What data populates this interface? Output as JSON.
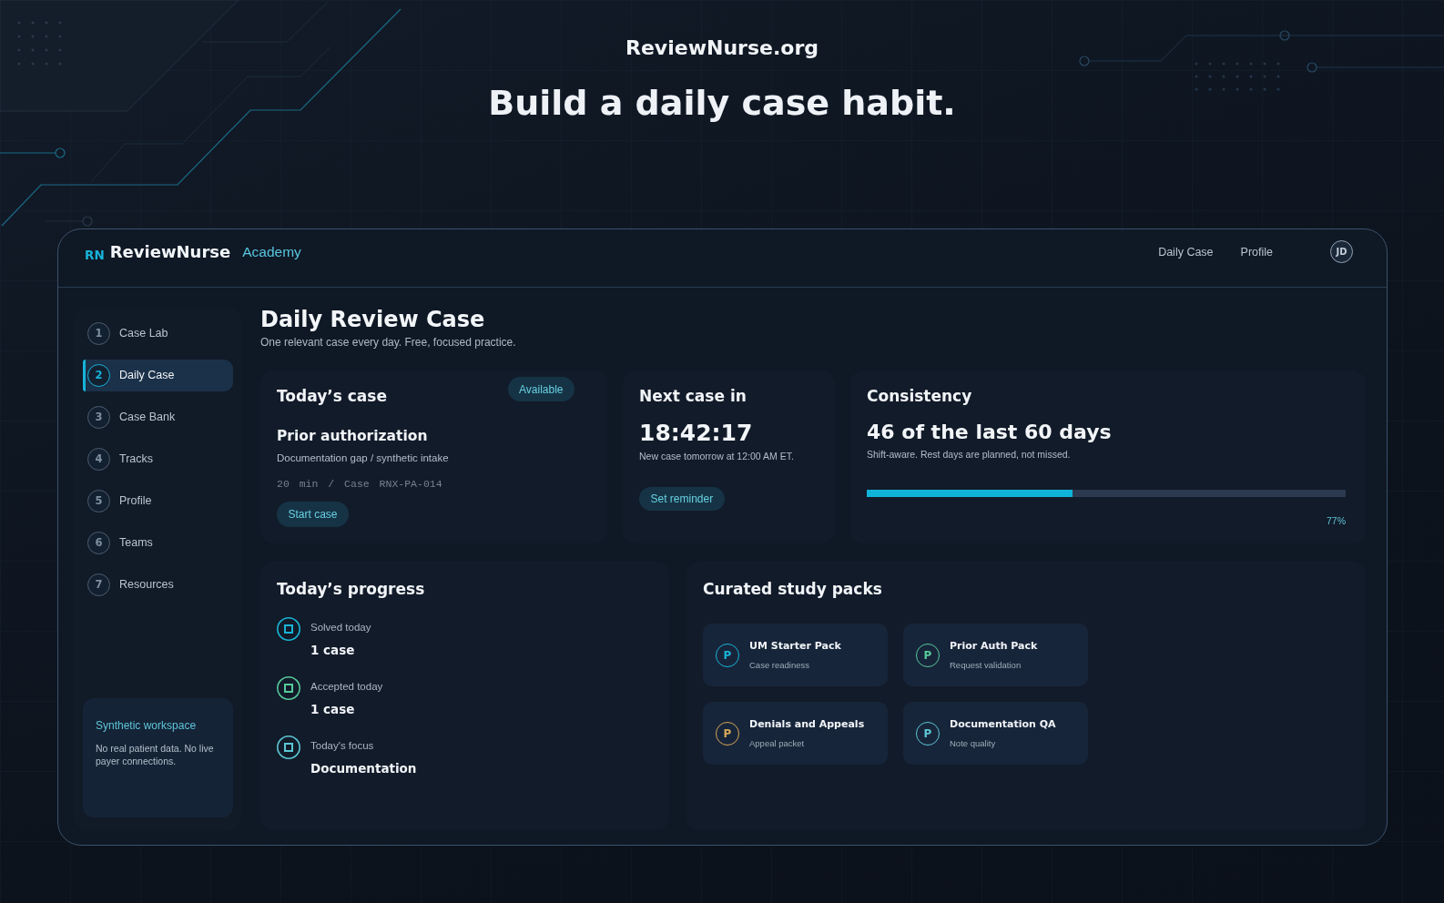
{
  "site": {
    "domain": "ReviewNurse.org",
    "headline": "Build a daily case habit."
  },
  "header": {
    "logo_mark": "RN",
    "brand": "ReviewNurse",
    "product": "Academy",
    "nav": [
      "Daily Case",
      "Profile"
    ],
    "avatar_initials": "JD"
  },
  "sidebar": {
    "items": [
      {
        "number": "1",
        "label": "Case Lab",
        "selected": false
      },
      {
        "number": "2",
        "label": "Daily Case",
        "selected": true
      },
      {
        "number": "3",
        "label": "Case Bank",
        "selected": false
      },
      {
        "number": "4",
        "label": "Tracks",
        "selected": false
      },
      {
        "number": "5",
        "label": "Profile",
        "selected": false
      },
      {
        "number": "6",
        "label": "Teams",
        "selected": false
      },
      {
        "number": "7",
        "label": "Resources",
        "selected": false
      }
    ],
    "notice": {
      "title": "Synthetic workspace",
      "text": "No real patient data. No live payer connections."
    }
  },
  "page": {
    "title": "Daily Review Case",
    "subtitle": "One relevant case every day. Free, focused practice."
  },
  "todays_case": {
    "title": "Today’s case",
    "status": "Available",
    "case_title": "Prior authorization",
    "description": "Documentation gap / synthetic intake",
    "meta": "20 min / Case RNX-PA-014",
    "button": "Start case"
  },
  "next_case": {
    "title": "Next case in",
    "countdown": "18:42:17",
    "note": "New case tomorrow at 12:00 AM ET.",
    "button": "Set reminder"
  },
  "consistency": {
    "title": "Consistency",
    "summary": "46 of the last 60 days",
    "note": "Shift-aware. Rest days are planned, not missed.",
    "level": 0.43,
    "reading": "77%"
  },
  "progress": {
    "title": "Today’s progress",
    "items": [
      {
        "label": "Solved today",
        "value": "1 case",
        "color": "#18b4d6"
      },
      {
        "label": "Accepted today",
        "value": "1 case",
        "color": "#56c99a"
      },
      {
        "label": "Today's focus",
        "value": "Documentation",
        "color": "#5cc6d4"
      }
    ]
  },
  "study_packs": {
    "title": "Curated study packs",
    "packs": [
      {
        "monogram": "P",
        "name": "UM Starter Pack",
        "subtitle": "Case readiness",
        "color": "#18b4d6"
      },
      {
        "monogram": "P",
        "name": "Prior Auth Pack",
        "subtitle": "Request validation",
        "color": "#56c99a"
      },
      {
        "monogram": "P",
        "name": "Denials and Appeals",
        "subtitle": "Appeal packet",
        "color": "#d6a758"
      },
      {
        "monogram": "P",
        "name": "Documentation QA",
        "subtitle": "Note quality",
        "color": "#5cc6d4"
      }
    ]
  }
}
